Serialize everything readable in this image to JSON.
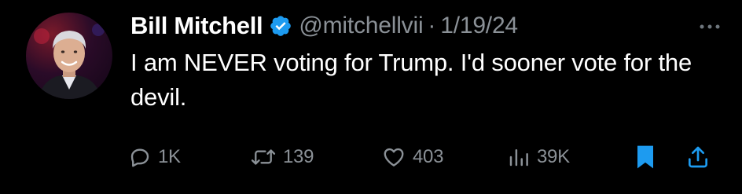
{
  "author": {
    "name": "Bill Mitchell",
    "handle": "@mitchellvii",
    "separator": "·",
    "date": "1/19/24",
    "verified": true,
    "verified_icon": "verified-badge-icon"
  },
  "tweet": {
    "text": "I am NEVER voting for Trump. I'd sooner vote for the devil."
  },
  "actions": {
    "reply_count": "1K",
    "repost_count": "139",
    "like_count": "403",
    "views_count": "39K"
  },
  "colors": {
    "background": "#000000",
    "text": "#ffffff",
    "muted": "#8b9197",
    "verified": "#1d9bf0",
    "bookmark_active": "#1d9bf0"
  },
  "icons": {
    "more": "more-dots-icon",
    "reply": "reply-icon",
    "repost": "repost-icon",
    "like": "heart-icon",
    "views": "views-chart-icon",
    "bookmark": "bookmark-icon",
    "share": "share-icon"
  }
}
